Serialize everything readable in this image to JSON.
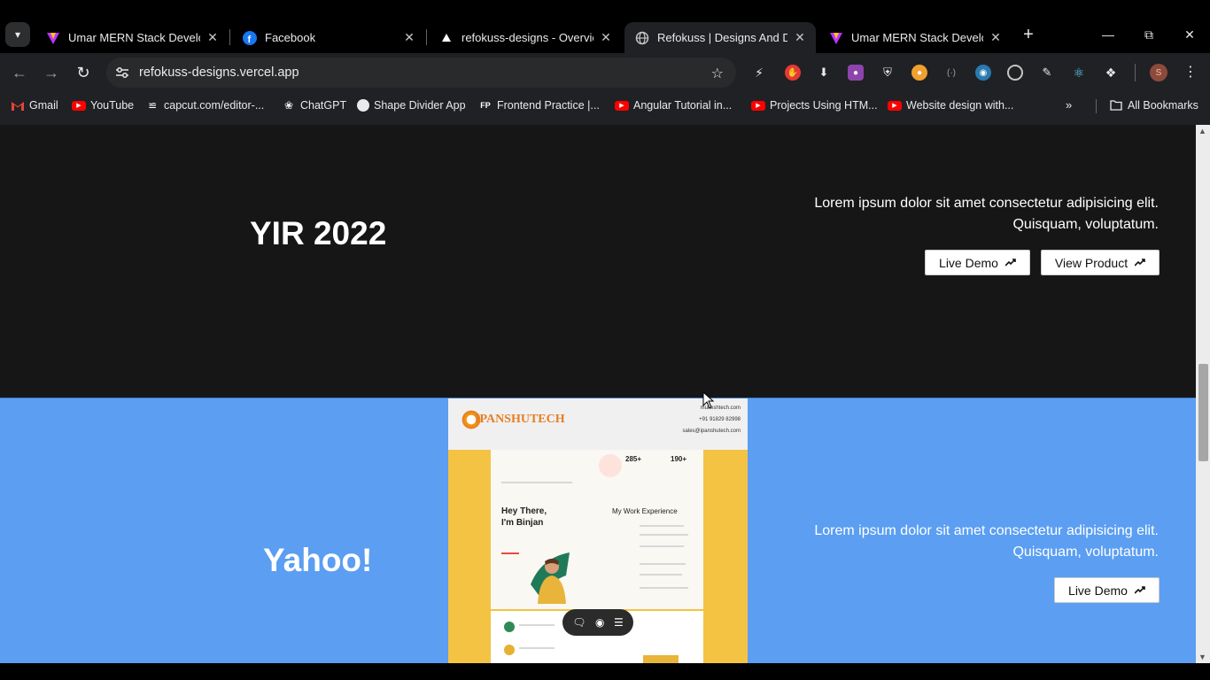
{
  "tabs": [
    {
      "title": "Umar MERN Stack Develope",
      "icon": "vite-logo-icon"
    },
    {
      "title": "Facebook",
      "icon": "facebook-icon"
    },
    {
      "title": "refokuss-designs - Overview",
      "icon": "vercel-triangle-icon"
    },
    {
      "title": "Refokuss | Designs And Dev",
      "icon": "globe-icon",
      "active": true
    },
    {
      "title": "Umar MERN Stack Develope",
      "icon": "vite-logo-icon"
    }
  ],
  "toolbar": {
    "url": "refokuss-designs.vercel.app"
  },
  "bookmarks": [
    {
      "label": "Gmail",
      "icon": "gmail-icon"
    },
    {
      "label": "YouTube",
      "icon": "youtube-icon"
    },
    {
      "label": "capcut.com/editor-...",
      "icon": "capcut-icon"
    },
    {
      "label": "ChatGPT",
      "icon": "chatgpt-icon"
    },
    {
      "label": "Shape Divider App",
      "icon": "shape-divider-icon"
    },
    {
      "label": "Frontend Practice |...",
      "icon": "fp-icon"
    },
    {
      "label": "Angular Tutorial in...",
      "icon": "youtube-icon"
    },
    {
      "label": "Projects Using HTM...",
      "icon": "youtube-icon"
    },
    {
      "label": "Website design with...",
      "icon": "youtube-icon"
    }
  ],
  "all_bookmarks": "All Bookmarks",
  "projects": [
    {
      "title": "YIR 2022",
      "desc_line1": "Lorem ipsum dolor sit amet consectetur adipisicing elit.",
      "desc_line2": "Quisquam, voluptatum.",
      "live_demo": "Live Demo",
      "view_product": "View Product",
      "bg": "#161616"
    },
    {
      "title": "Yahoo!",
      "desc_line1": "Lorem ipsum dolor sit amet consectetur adipisicing elit.",
      "desc_line2": "Quisquam, voluptatum.",
      "live_demo": "Live Demo",
      "bg": "#5b9ef2"
    }
  ],
  "preview": {
    "logo_text": "IPANSHUTECH",
    "email": "mukeshtech.com",
    "phone": "+91 91829 82998",
    "sales": "sales@ipanshutech.com",
    "stat1": "285+",
    "stat2": "190+",
    "greeting_line1": "Hey There,",
    "greeting_line2": "I'm Binjan",
    "experience": "My Work Experience"
  }
}
